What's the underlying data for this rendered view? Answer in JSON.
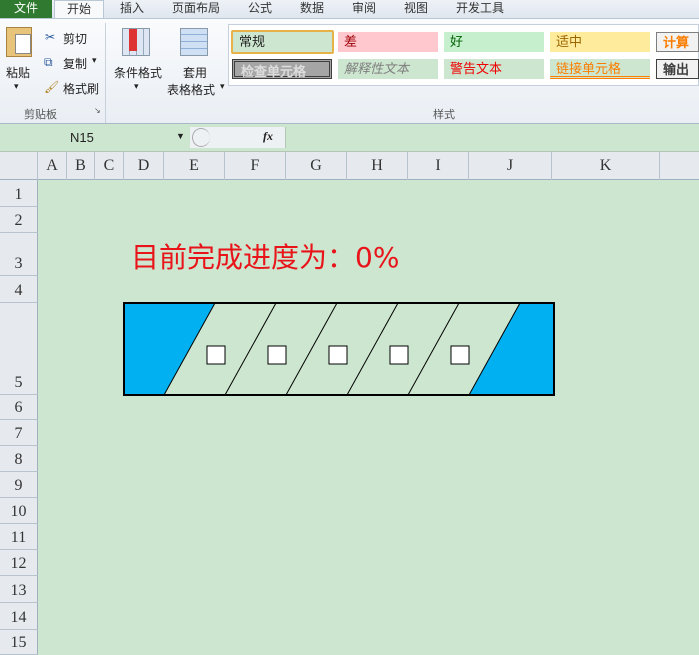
{
  "ribbon_tabs": [
    "文件",
    "开始",
    "插入",
    "页面布局",
    "公式",
    "数据",
    "审阅",
    "视图",
    "开发工具"
  ],
  "clipboard": {
    "paste": "粘贴",
    "cut": "剪切",
    "copy": "复制",
    "format_painter": "格式刷",
    "group": "剪贴板"
  },
  "styles_group": {
    "conditional": "条件格式",
    "table_line1": "套用",
    "table_line2": "表格格式",
    "group": "样式",
    "cells": [
      "常规",
      "差",
      "好",
      "适中",
      "计算",
      "检查单元格",
      "解释性文本",
      "警告文本",
      "链接单元格",
      "输出"
    ]
  },
  "formula_bar": {
    "name_box": "N15",
    "fx": "fx",
    "formula": ""
  },
  "columns": [
    "A",
    "B",
    "C",
    "D",
    "E",
    "F",
    "G",
    "H",
    "I",
    "J",
    "K"
  ],
  "rows": [
    "1",
    "2",
    "3",
    "4",
    "5",
    "6",
    "7",
    "8",
    "9",
    "10",
    "11",
    "12",
    "13",
    "14",
    "15"
  ],
  "sheet": {
    "progress_label": "目前完成进度为：0%",
    "progress_percent": 0,
    "fill_color": "#00b0f0",
    "segments": 5
  }
}
